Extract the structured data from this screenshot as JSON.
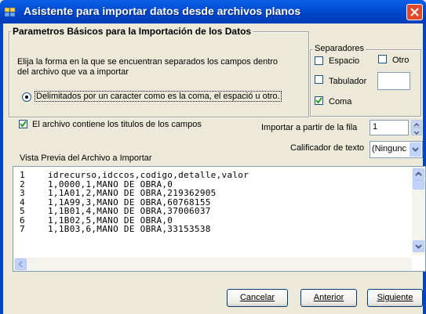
{
  "window": {
    "title": "Asistente para importar datos desde archivos planos"
  },
  "basic_group": {
    "title": "Parametros Básicos para la Importación de los Datos",
    "description_line1": "Elija la forma en la que se encuentran separados los campos dentro",
    "description_line2": "del archivo que va a importar",
    "delimited_option": "Delimitados por un caracter como es la coma, el espació u otro."
  },
  "separators": {
    "title": "Separadores",
    "space": "Espacio",
    "other": "Otro",
    "tab": "Tabulador",
    "comma": "Coma",
    "other_value": ""
  },
  "header_checkbox": {
    "label": "El archivo contiene los titulos de los campos",
    "checked": true
  },
  "start_row": {
    "label": "Importar a partir de la fila",
    "value": "1"
  },
  "text_qualifier": {
    "label": "Calificador de texto",
    "value": "(Ningunc"
  },
  "preview": {
    "title": "Vista Previa del Archivo a Importar",
    "line_numbers": [
      "1",
      "2",
      "3",
      "4",
      "5",
      "6",
      "7"
    ],
    "lines": [
      "idrecurso,idccos,codigo,detalle,valor",
      "1,0000,1,MANO DE OBRA,0",
      "1,1A01,2,MANO DE OBRA,219362905",
      "1,1A99,3,MANO DE OBRA,60768155",
      "1,1B01,4,MANO DE OBRA,37006037",
      "1,1B02,5,MANO DE OBRA,0",
      "1,1B03,6,MANO DE OBRA,33153538"
    ]
  },
  "buttons": {
    "cancel": "Cancelar",
    "back": "Anterior",
    "next": "Siguiente"
  }
}
